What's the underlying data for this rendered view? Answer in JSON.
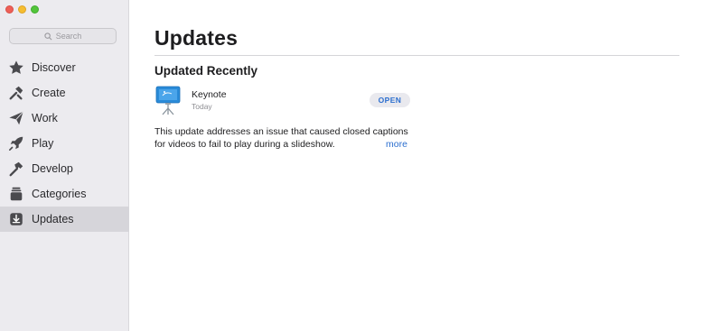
{
  "window": {
    "controls": [
      "close",
      "minimize",
      "zoom"
    ]
  },
  "search": {
    "placeholder": "Search",
    "icon": "search-icon"
  },
  "sidebar": {
    "items": [
      {
        "label": "Discover",
        "icon": "star-icon",
        "active": false
      },
      {
        "label": "Create",
        "icon": "hammer-brush-icon",
        "active": false
      },
      {
        "label": "Work",
        "icon": "paper-plane-icon",
        "active": false
      },
      {
        "label": "Play",
        "icon": "rocket-icon",
        "active": false
      },
      {
        "label": "Develop",
        "icon": "hammer-icon",
        "active": false
      },
      {
        "label": "Categories",
        "icon": "stack-icon",
        "active": false
      },
      {
        "label": "Updates",
        "icon": "download-tray-icon",
        "active": true
      }
    ]
  },
  "main": {
    "title": "Updates",
    "section_title": "Updated Recently",
    "update": {
      "app_name": "Keynote",
      "date": "Today",
      "button_label": "OPEN",
      "notes_line1": "This update addresses an issue that caused closed captions",
      "notes_line2": "for videos to fail to play during a slideshow.",
      "more_label": "more"
    }
  },
  "colors": {
    "accent": "#2c6fcf",
    "sidebar_bg": "#ecebef",
    "active_item_bg": "#d6d5da"
  }
}
